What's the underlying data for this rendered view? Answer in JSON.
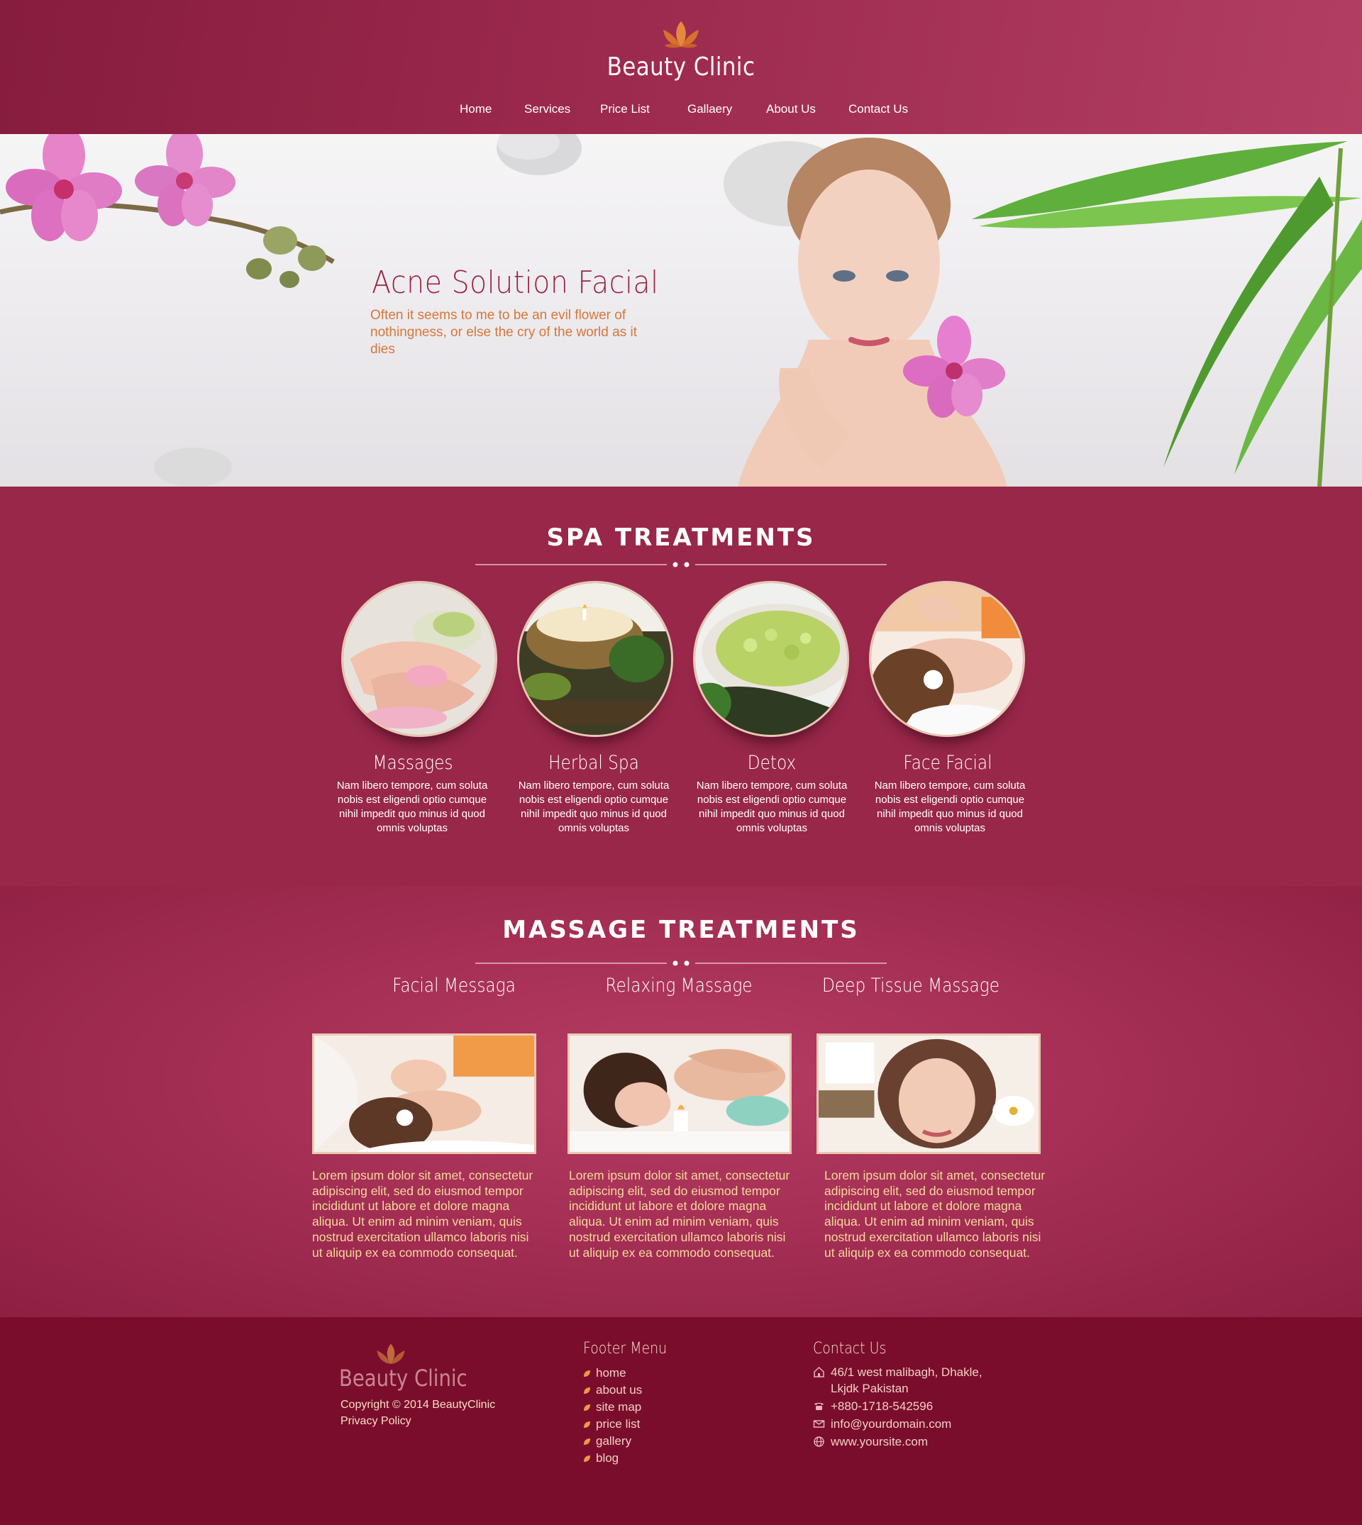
{
  "brand": {
    "name": "Beauty Clinic"
  },
  "nav": [
    {
      "label": "Home"
    },
    {
      "label": "Services"
    },
    {
      "label": "Price List"
    },
    {
      "label": "Gallaery"
    },
    {
      "label": "About Us"
    },
    {
      "label": "Contact Us"
    }
  ],
  "hero": {
    "title": "Acne Solution Facial",
    "text": "Often it seems to me to be an evil flower of nothingness, or else the cry of the world as it dies"
  },
  "spa": {
    "title": "SPA TREATMENTS",
    "items": [
      {
        "title": "Massages",
        "text": "Nam libero tempore, cum soluta nobis est eligendi optio cumque nihil impedit quo minus id quod omnis voluptas"
      },
      {
        "title": "Herbal Spa",
        "text": "Nam libero tempore, cum soluta nobis est eligendi optio cumque nihil impedit quo minus id quod omnis voluptas"
      },
      {
        "title": "Detox",
        "text": "Nam libero tempore, cum soluta nobis est eligendi optio cumque nihil impedit quo minus id quod omnis voluptas"
      },
      {
        "title": "Face Facial",
        "text": "Nam libero tempore, cum soluta nobis est eligendi optio cumque nihil impedit quo minus id quod omnis voluptas"
      }
    ]
  },
  "massage": {
    "title": "MASSAGE TREATMENTS",
    "items": [
      {
        "title": "Facial Messaga",
        "text": "Lorem ipsum dolor sit amet, consectetur adipiscing elit, sed do eiusmod tempor incididunt ut labore et dolore magna aliqua. Ut enim ad minim veniam, quis nostrud exercitation ullamco laboris nisi ut aliquip ex ea commodo consequat."
      },
      {
        "title": "Relaxing Massage",
        "text": "Lorem ipsum dolor sit amet, consectetur adipiscing elit, sed do eiusmod tempor incididunt ut labore et dolore magna aliqua. Ut enim ad minim veniam, quis nostrud exercitation ullamco laboris nisi ut aliquip ex ea commodo consequat."
      },
      {
        "title": "Deep Tissue Massage",
        "text": "Lorem ipsum dolor sit amet, consectetur adipiscing elit, sed do eiusmod tempor incididunt ut labore et dolore magna aliqua. Ut enim ad minim veniam, quis nostrud exercitation ullamco laboris nisi ut aliquip ex ea commodo consequat."
      }
    ]
  },
  "footer": {
    "logo": "Beauty Clinic",
    "copyright": "Copyright © 2014 BeautyClinic",
    "privacy": "Privacy Policy",
    "menu_title": "Footer Menu",
    "menu": [
      "home",
      "about us",
      "site map",
      "price list",
      "gallery",
      "blog"
    ],
    "contact_title": "Contact Us",
    "address_line1": "46/1 west malibagh, Dhakle,",
    "address_line2": "Lkjdk Pakistan",
    "phone": "+880-1718-542596",
    "email": "info@yourdomain.com",
    "website": "www.yoursite.com"
  },
  "colors": {
    "header": "#9c2a4e",
    "spa_bg": "#982749",
    "footer_bg": "#7b0d2c",
    "accent_text": "#f5d89a",
    "hero_title": "#9b2447",
    "hero_text": "#d6773a"
  }
}
